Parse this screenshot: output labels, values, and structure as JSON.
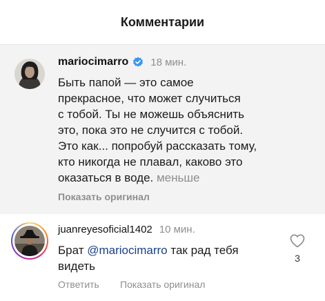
{
  "header": {
    "title": "Комментарии"
  },
  "comments": [
    {
      "username": "mariocimarro",
      "verified": true,
      "time": "18 мин.",
      "lines": [
        "Быть папой — это самое",
        "прекрасное, что может случиться",
        "с тобой. Ты не можешь объяснить",
        "это, пока это не случится с тобой.",
        "Это как... попробуй рассказать тому,",
        "кто никогда не плавал, каково это",
        "оказаться в воде."
      ],
      "less_label": "меньше",
      "show_original": "Показать оригинал"
    },
    {
      "username": "juanreyesoficial1402",
      "time": "10 мин.",
      "text_before_mention": "Брат ",
      "mention": "@mariocimarro",
      "text_after_mention": " так рад тебя",
      "text_line2": "видеть",
      "reply_label": "Ответить",
      "show_original": "Показать оригинал",
      "like_count": "3"
    }
  ],
  "icons": {
    "verified": "verified-badge-icon",
    "like": "heart-outline-icon"
  },
  "colors": {
    "verified_blue": "#3897f0",
    "highlight_bg": "#f3f3f3",
    "muted_text": "#8e8e8e",
    "mention": "#1a3f8a"
  }
}
